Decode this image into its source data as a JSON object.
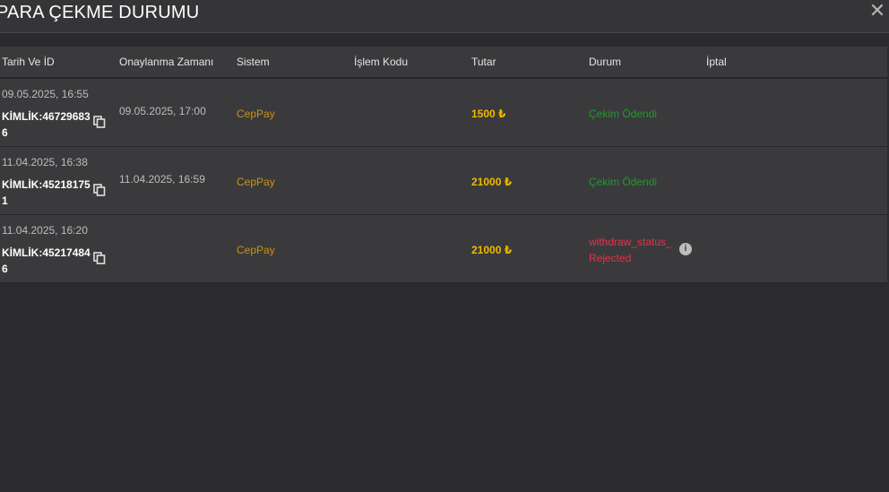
{
  "header": {
    "title": "PARA ÇEKME DURUMU",
    "close_symbol": "✕"
  },
  "table": {
    "columns": [
      "Tarih Ve İD",
      "Onaylanma Zamanı",
      "Sistem",
      "İşlem Kodu",
      "Tutar",
      "Durum",
      "İptal"
    ],
    "rows": [
      {
        "date": "09.05.2025, 16:55",
        "kimlik": "KİMLİK:467296836",
        "approved": "09.05.2025, 17:00",
        "system": "CepPay",
        "code": "",
        "amount": "1500 ₺",
        "status": "Çekim Ödendi",
        "status_type": "ok",
        "cancel": ""
      },
      {
        "date": "11.04.2025, 16:38",
        "kimlik": "KİMLİK:452181751",
        "approved": "11.04.2025, 16:59",
        "system": "CepPay",
        "code": "",
        "amount": "21000 ₺",
        "status": "Çekim Ödendi",
        "status_type": "ok",
        "cancel": ""
      },
      {
        "date": "11.04.2025, 16:20",
        "kimlik": "KİMLİK:452174846",
        "approved": "",
        "system": "CepPay",
        "code": "",
        "amount": "21000 ₺",
        "status": "withdraw_status_Rejected",
        "status_type": "rejected",
        "cancel": ""
      }
    ]
  },
  "colors": {
    "background": "#2b2b2d",
    "panel": "#3a3a3c",
    "system_text": "#c8931a",
    "amount_text": "#f2b800",
    "status_ok": "#1f9a2c",
    "status_rejected": "#e0344c"
  },
  "icons": {
    "close": "close-icon",
    "copy": "copy-icon",
    "info": "info-icon"
  }
}
